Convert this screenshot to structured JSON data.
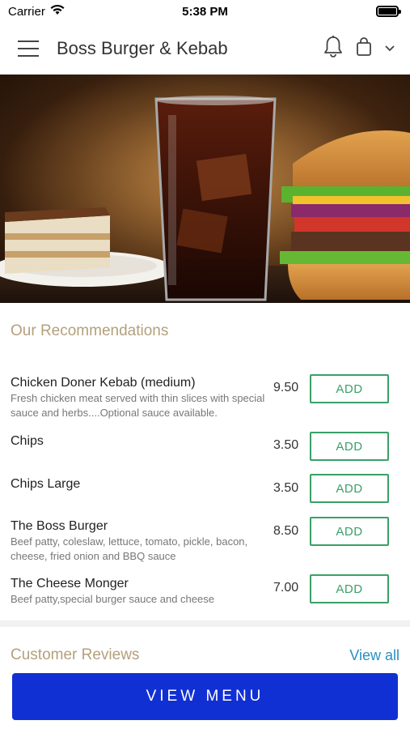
{
  "status_bar": {
    "carrier": "Carrier",
    "time": "5:38 PM"
  },
  "header": {
    "title": "Boss Burger & Kebab"
  },
  "recommendations": {
    "title": "Our Recommendations",
    "add_label": "ADD",
    "items": [
      {
        "name": "Chicken Doner Kebab (medium)",
        "description": "Fresh chicken meat served with thin slices with special sauce and  herbs....Optional sauce available.",
        "price": "9.50"
      },
      {
        "name": "Chips",
        "description": "",
        "price": "3.50"
      },
      {
        "name": "Chips Large",
        "description": "",
        "price": "3.50"
      },
      {
        "name": "The Boss Burger",
        "description": "Beef patty, coleslaw, lettuce, tomato, pickle, bacon, cheese, fried onion and BBQ sauce",
        "price": "8.50"
      },
      {
        "name": "The Cheese Monger",
        "description": "Beef patty,special burger sauce and cheese",
        "price": "7.00"
      }
    ]
  },
  "reviews": {
    "title": "Customer Reviews",
    "view_all": "View all"
  },
  "footer": {
    "view_menu": "VIEW MENU"
  },
  "colors": {
    "accent_title": "#b4a07c",
    "add_green": "#3aa068",
    "link_blue": "#2a8fbd",
    "primary_blue": "#1130d4"
  }
}
